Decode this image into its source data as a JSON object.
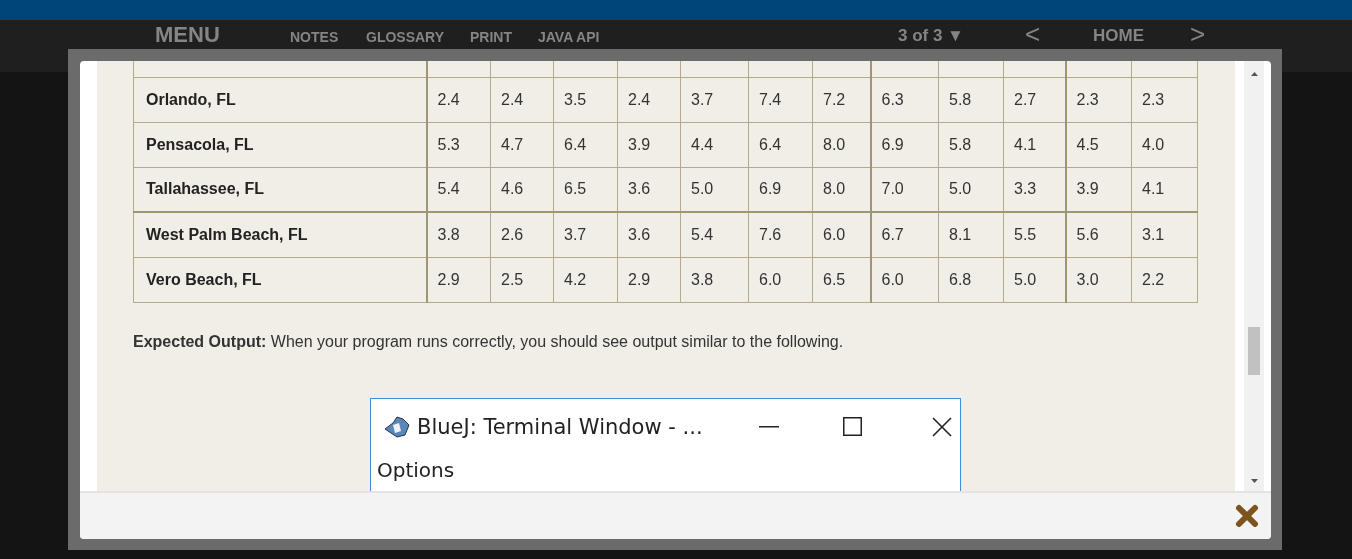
{
  "nav": {
    "menu": "MENU",
    "links": [
      "NOTES",
      "GLOSSARY",
      "PRINT",
      "JAVA API"
    ],
    "page": "3 of 3 ▼",
    "prev": "<",
    "home": "HOME",
    "next": ">"
  },
  "table": {
    "rows": [
      {
        "city": "Orlando, FL",
        "values": [
          "2.4",
          "2.4",
          "3.5",
          "2.4",
          "3.7",
          "7.4",
          "7.2",
          "6.3",
          "5.8",
          "2.7",
          "2.3",
          "2.3"
        ]
      },
      {
        "city": "Pensacola, FL",
        "values": [
          "5.3",
          "4.7",
          "6.4",
          "3.9",
          "4.4",
          "6.4",
          "8.0",
          "6.9",
          "5.8",
          "4.1",
          "4.5",
          "4.0"
        ]
      },
      {
        "city": "Tallahassee, FL",
        "values": [
          "5.4",
          "4.6",
          "6.5",
          "3.6",
          "5.0",
          "6.9",
          "8.0",
          "7.0",
          "5.0",
          "3.3",
          "3.9",
          "4.1"
        ]
      },
      {
        "city": "West Palm Beach, FL",
        "values": [
          "3.8",
          "2.6",
          "3.7",
          "3.6",
          "5.4",
          "7.6",
          "6.0",
          "6.7",
          "8.1",
          "5.5",
          "5.6",
          "3.1"
        ]
      },
      {
        "city": "Vero Beach, FL",
        "values": [
          "2.9",
          "2.5",
          "4.2",
          "2.9",
          "3.8",
          "6.0",
          "6.5",
          "6.0",
          "6.8",
          "5.0",
          "3.0",
          "2.2"
        ]
      }
    ]
  },
  "expected_output": "**Expected Output:** When your program runs correctly, you should see output similar to the following.",
  "terminal": {
    "title": "BlueJ: Terminal Window - ...",
    "menu": "Options"
  }
}
